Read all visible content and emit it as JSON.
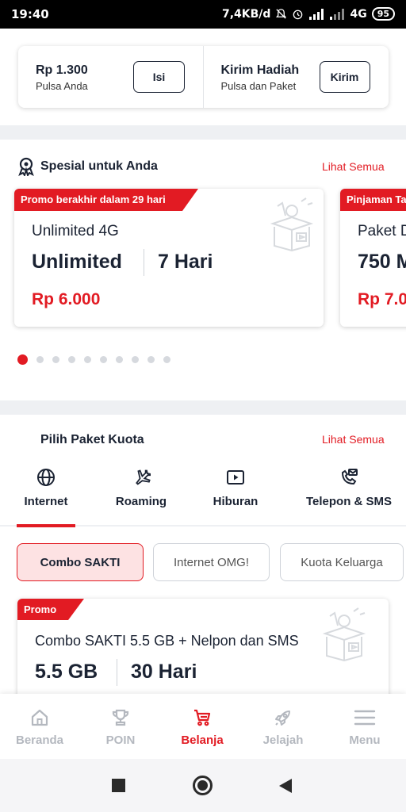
{
  "status_bar": {
    "time": "19:40",
    "net_speed": "7,4KB/d",
    "network_type": "4G",
    "battery": "95"
  },
  "balance_card": {
    "amount": "Rp 1.300",
    "amount_label": "Pulsa Anda",
    "topup_button": "Isi",
    "gift_title": "Kirim Hadiah",
    "gift_sub": "Pulsa dan Paket",
    "gift_button": "Kirim"
  },
  "special_section": {
    "title": "Spesial untuk Anda",
    "see_all": "Lihat Semua",
    "cards": [
      {
        "ribbon": "Promo berakhir dalam 29 hari",
        "name": "Unlimited 4G",
        "quota": "Unlimited",
        "duration": "7 Hari",
        "price": "Rp 6.000"
      },
      {
        "ribbon": "Pinjaman Ta",
        "name": "Paket D",
        "quota": "750 M",
        "price": "Rp 7.0"
      }
    ],
    "carousel_pages": 10,
    "carousel_active_index": 0
  },
  "package_section": {
    "title": "Pilih Paket Kuota",
    "see_all": "Lihat Semua",
    "categories": [
      {
        "label": "Internet",
        "icon": "globe-icon",
        "active": true
      },
      {
        "label": "Roaming",
        "icon": "airplane-icon",
        "active": false
      },
      {
        "label": "Hiburan",
        "icon": "play-icon",
        "active": false
      },
      {
        "label": "Telepon & SMS",
        "icon": "phone-message-icon",
        "active": false
      }
    ],
    "chips": [
      "Combo SAKTI",
      "Internet OMG!",
      "Kuota Keluarga"
    ],
    "active_chip": "Combo SAKTI",
    "card": {
      "ribbon": "Promo",
      "name": "Combo SAKTI 5.5 GB + Nelpon dan SMS",
      "quota": "5.5 GB",
      "duration": "30 Hari"
    }
  },
  "bottom_nav": {
    "items": [
      {
        "label": "Beranda",
        "icon": "home-icon"
      },
      {
        "label": "POIN",
        "icon": "trophy-icon"
      },
      {
        "label": "Belanja",
        "icon": "cart-icon"
      },
      {
        "label": "Jelajah",
        "icon": "rocket-icon"
      },
      {
        "label": "Menu",
        "icon": "menu-icon"
      }
    ],
    "active": "Belanja"
  },
  "colors": {
    "accent": "#e21b23",
    "text": "#1b2333",
    "inactive": "#b4b8bf",
    "chip_active_bg": "#fde2e3"
  }
}
